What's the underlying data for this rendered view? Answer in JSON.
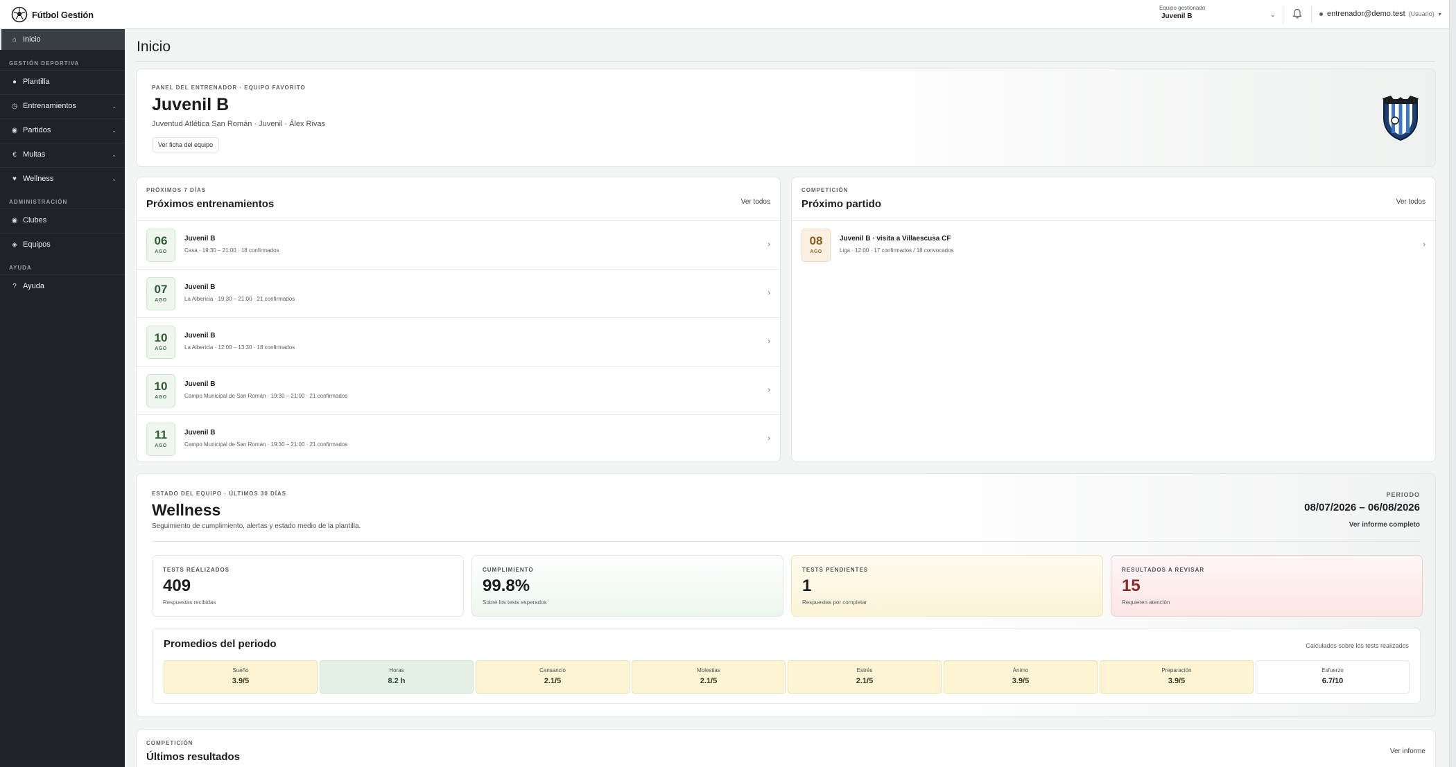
{
  "app": {
    "brand": "Fútbol Gestión",
    "team_select": {
      "label": "Equipo gestionado",
      "value": "Juvenil B"
    },
    "user": {
      "email": "entrenador@demo.test",
      "role": "(Usuario)"
    }
  },
  "sidebar": {
    "home": "Inicio",
    "sections": {
      "sport": "GESTIÓN DEPORTIVA",
      "admin": "ADMINISTRACIÓN",
      "help": "AYUDA"
    },
    "items": {
      "plantilla": "Plantilla",
      "entrenamientos": "Entrenamientos",
      "partidos": "Partidos",
      "multas": "Multas",
      "wellness": "Wellness",
      "clubes": "Clubes",
      "equipos": "Equipos",
      "ayuda": "Ayuda"
    }
  },
  "page": {
    "title": "Inicio"
  },
  "hero": {
    "eyebrow": "PANEL DEL ENTRENADOR · EQUIPO FAVORITO",
    "team": "Juvenil B",
    "subtitle": "Juventud Atlética San Román · Juvenil · Álex Rivas",
    "button": "Ver ficha del equipo"
  },
  "trainings": {
    "eyebrow": "PRÓXIMOS 7 DÍAS",
    "title": "Próximos entrenamientos",
    "link": "Ver todos",
    "rows": [
      {
        "day": "06",
        "month": "AGO",
        "title": "Juvenil B",
        "sub": "Casa · 19:30 – 21:00 · 18 confirmados"
      },
      {
        "day": "07",
        "month": "AGO",
        "title": "Juvenil B",
        "sub": "La Albericia · 19:30 – 21:00 · 21 confirmados"
      },
      {
        "day": "10",
        "month": "AGO",
        "title": "Juvenil B",
        "sub": "La Albericia · 12:00 – 13:30 · 18 confirmados"
      },
      {
        "day": "10",
        "month": "AGO",
        "title": "Juvenil B",
        "sub": "Campo Municipal de San Román · 19:30 – 21:00 · 21 confirmados"
      },
      {
        "day": "11",
        "month": "AGO",
        "title": "Juvenil B",
        "sub": "Campo Municipal de San Román · 19:30 – 21:00 · 21 confirmados"
      }
    ]
  },
  "match": {
    "eyebrow": "COMPETICIÓN",
    "title": "Próximo partido",
    "link": "Ver todos",
    "row": {
      "day": "08",
      "month": "AGO",
      "title": "Juvenil B · visita a Villaescusa CF",
      "sub": "Liga · 12:00 · 17 confirmados / 18 convocados"
    }
  },
  "wellness": {
    "eyebrow": "ESTADO DEL EQUIPO · ÚLTIMOS 30 DÍAS",
    "title": "Wellness",
    "subtitle": "Seguimiento de cumplimiento, alertas y estado medio de la plantilla.",
    "period_label": "PERIODO",
    "period": "08/07/2026 – 06/08/2026",
    "report_link": "Ver informe completo",
    "stats": [
      {
        "label": "TESTS REALIZADOS",
        "value": "409",
        "desc": "Respuestas recibidas"
      },
      {
        "label": "CUMPLIMIENTO",
        "value": "99.8%",
        "desc": "Sobre los tests esperados"
      },
      {
        "label": "TESTS PENDIENTES",
        "value": "1",
        "desc": "Respuestas por completar"
      },
      {
        "label": "RESULTADOS A REVISAR",
        "value": "15",
        "desc": "Requieren atención"
      }
    ],
    "averages": {
      "title": "Promedios del periodo",
      "note": "Calculados sobre los tests realizados",
      "metrics": [
        {
          "label": "Sueño",
          "value": "3.9/5"
        },
        {
          "label": "Horas",
          "value": "8.2 h"
        },
        {
          "label": "Cansancio",
          "value": "2.1/5"
        },
        {
          "label": "Molestias",
          "value": "2.1/5"
        },
        {
          "label": "Estrés",
          "value": "2.1/5"
        },
        {
          "label": "Ánimo",
          "value": "3.9/5"
        },
        {
          "label": "Preparación",
          "value": "3.9/5"
        },
        {
          "label": "Esfuerzo",
          "value": "6.7/10"
        }
      ]
    }
  },
  "results": {
    "eyebrow": "COMPETICIÓN",
    "title": "Últimos resultados",
    "link": "Ver informe"
  },
  "colors": {
    "sidebar": "#1f2327",
    "accent_green": "#2f5b34",
    "alert_red": "#8d2b2b",
    "warn_yellow": "#fcf4d3"
  }
}
